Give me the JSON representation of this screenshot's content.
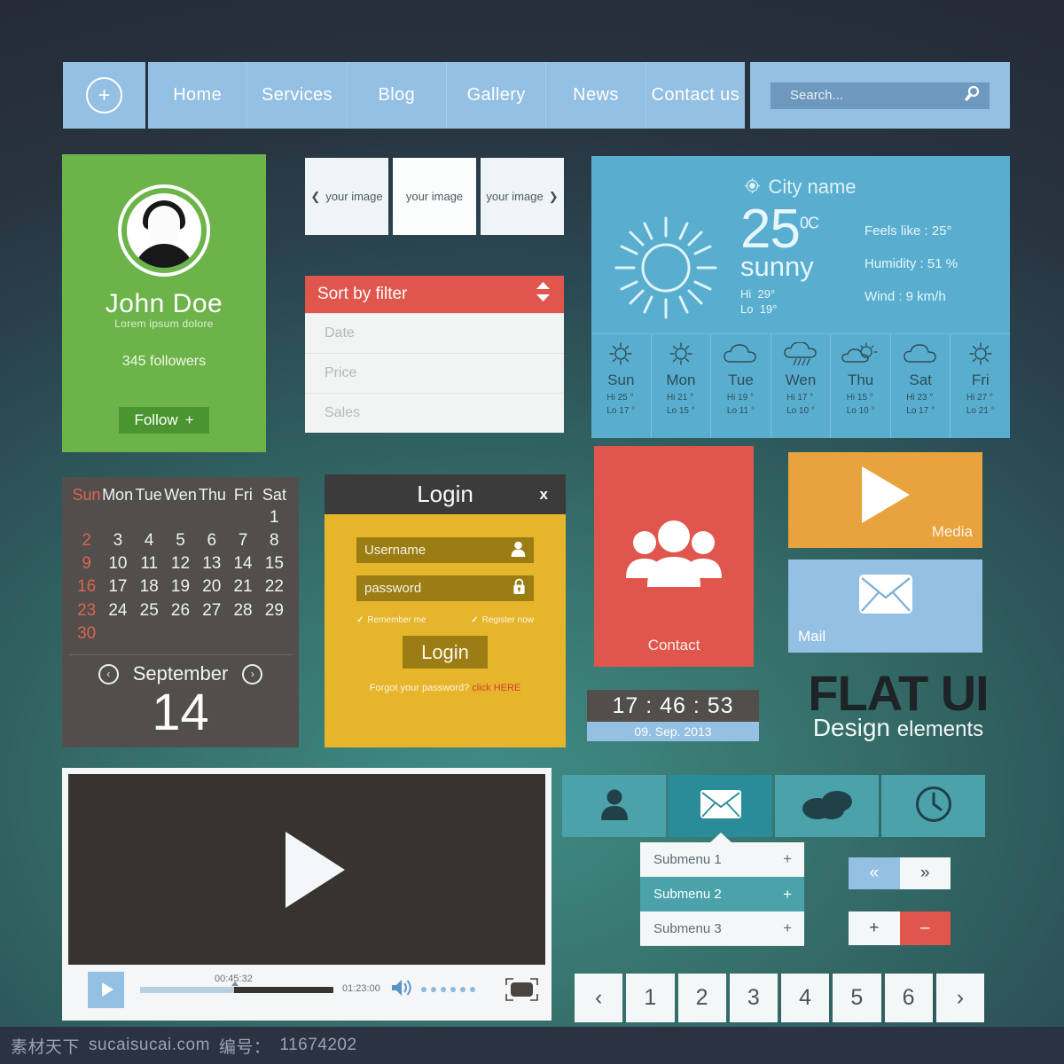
{
  "nav": {
    "plus_label": "+",
    "items": [
      "Home",
      "Services",
      "Blog",
      "Gallery",
      "News",
      "Contact us"
    ],
    "search_placeholder": "Search...",
    "search_icon": "magnifier-icon"
  },
  "profile": {
    "name": "John Doe",
    "subtitle": "Lorem ipsum dolore",
    "followers": "345 followers",
    "follow_label": "Follow",
    "follow_plus": "+",
    "bg_color": "#6cb44a",
    "button_color": "#4b9530"
  },
  "carousel": {
    "prev_icon": "❮",
    "next_icon": "❯",
    "slides": [
      "your image",
      "your image",
      "your image"
    ]
  },
  "sort": {
    "title": "Sort by filter",
    "header_color": "#e0564c",
    "rows": [
      "Date",
      "Price",
      "Sales"
    ]
  },
  "weather": {
    "city": "City name",
    "locate_icon": "target-icon",
    "temp": "25",
    "degree": "0",
    "unit": "C",
    "condition": "sunny",
    "hi_label": "Hi",
    "hi": "29",
    "lo_label": "Lo",
    "lo": "19",
    "feels_like": "Feels like : 25°",
    "humidity": "Humidity : 51 %",
    "wind": "Wind : 9 km/h",
    "bg_color": "#59aed0",
    "forecast": [
      {
        "day": "Sun",
        "icon": "sun-icon",
        "hi": "Hi  25 °",
        "lo": "Lo  17 °"
      },
      {
        "day": "Mon",
        "icon": "sun-icon",
        "hi": "Hi  21 °",
        "lo": "Lo  15 °"
      },
      {
        "day": "Tue",
        "icon": "cloud-icon",
        "hi": "Hi  19 °",
        "lo": "Lo  11 °"
      },
      {
        "day": "Wen",
        "icon": "rain-icon",
        "hi": "Hi  17 °",
        "lo": "Lo  10 °"
      },
      {
        "day": "Thu",
        "icon": "partly-cloudy-icon",
        "hi": "Hi  15 °",
        "lo": "Lo  10 °"
      },
      {
        "day": "Sat",
        "icon": "cloud-icon",
        "hi": "Hi  23 °",
        "lo": "Lo  17 °"
      },
      {
        "day": "Fri",
        "icon": "sun-icon",
        "hi": "Hi  27 °",
        "lo": "Lo  21 °"
      }
    ]
  },
  "calendar": {
    "weekdays": [
      "Sun",
      "Mon",
      "Tue",
      "Wen",
      "Thu",
      "Fri",
      "Sat"
    ],
    "weeks": [
      [
        "",
        "",
        "",
        "",
        "",
        "",
        "1"
      ],
      [
        "2",
        "3",
        "4",
        "5",
        "6",
        "7",
        "8"
      ],
      [
        "9",
        "10",
        "11",
        "12",
        "13",
        "14",
        "15"
      ],
      [
        "16",
        "17",
        "18",
        "19",
        "20",
        "21",
        "22"
      ],
      [
        "23",
        "24",
        "25",
        "26",
        "27",
        "28",
        "29"
      ],
      [
        "30",
        "",
        "",
        "",
        "",
        "",
        ""
      ]
    ],
    "month": "September",
    "selected_day": "14",
    "prev_icon": "‹",
    "next_icon": "›",
    "bg_color": "#514e4c",
    "sunday_color": "#dd6452"
  },
  "login": {
    "title": "Login",
    "close_label": "x",
    "username_placeholder": "Username",
    "username_icon": "user-icon",
    "password_placeholder": "password",
    "password_icon": "lock-icon",
    "remember_label": "Remember me",
    "register_label": "Register now",
    "check_icon": "✓",
    "submit_label": "Login",
    "forgot_text": "Forgot your password?",
    "forgot_link": "click HERE",
    "bg_color": "#e6b52c",
    "header_color": "#3b3b3b"
  },
  "tiles": {
    "contact": {
      "label": "Contact",
      "icon": "people-group-icon",
      "color": "#e0564c"
    },
    "media": {
      "label": "Media",
      "icon": "play-icon",
      "color": "#e9a33e"
    },
    "mail": {
      "label": "Mail",
      "icon": "envelope-icon",
      "color": "#94c0e3"
    }
  },
  "clock": {
    "time": "17 : 46 : 53",
    "date": "09. Sep. 2013",
    "time_bg": "#514e4c",
    "date_bg": "#94c0e3"
  },
  "branding": {
    "title": "FLAT UI",
    "subtitle_strong": "Design",
    "subtitle_light": "elements"
  },
  "player": {
    "big_play_icon": "play-icon",
    "play_icon": "play-icon",
    "current_time": "00:45:32",
    "total_time": "01:23:00",
    "volume_icon": "speaker-icon",
    "volume_dots": 6,
    "fullscreen_icon": "fullscreen-icon",
    "screen_color": "#37332f",
    "progress_percent": 48
  },
  "icontabs": {
    "items": [
      {
        "icon": "user-icon",
        "active": false
      },
      {
        "icon": "envelope-icon",
        "active": true
      },
      {
        "icon": "clouds-icon",
        "active": false
      },
      {
        "icon": "clock-icon",
        "active": false
      }
    ],
    "active_color": "#2a8c99",
    "base_color": "#4ba2ab"
  },
  "submenu": {
    "items": [
      {
        "label": "Submenu 1",
        "plus": "+",
        "selected": false
      },
      {
        "label": "Submenu 2",
        "plus": "+",
        "selected": true
      },
      {
        "label": "Submenu 3",
        "plus": "+",
        "selected": false
      }
    ]
  },
  "steppers": {
    "prev_label": "«",
    "next_label": "»",
    "plus_label": "+",
    "minus_label": "–"
  },
  "pagination": {
    "prev_icon": "‹",
    "next_icon": "›",
    "pages": [
      "1",
      "2",
      "3",
      "4",
      "5",
      "6"
    ]
  },
  "watermark": {
    "site_cn": "素材天下",
    "site": "sucaisucai.com",
    "id_label": "编号：",
    "id": "11674202"
  }
}
